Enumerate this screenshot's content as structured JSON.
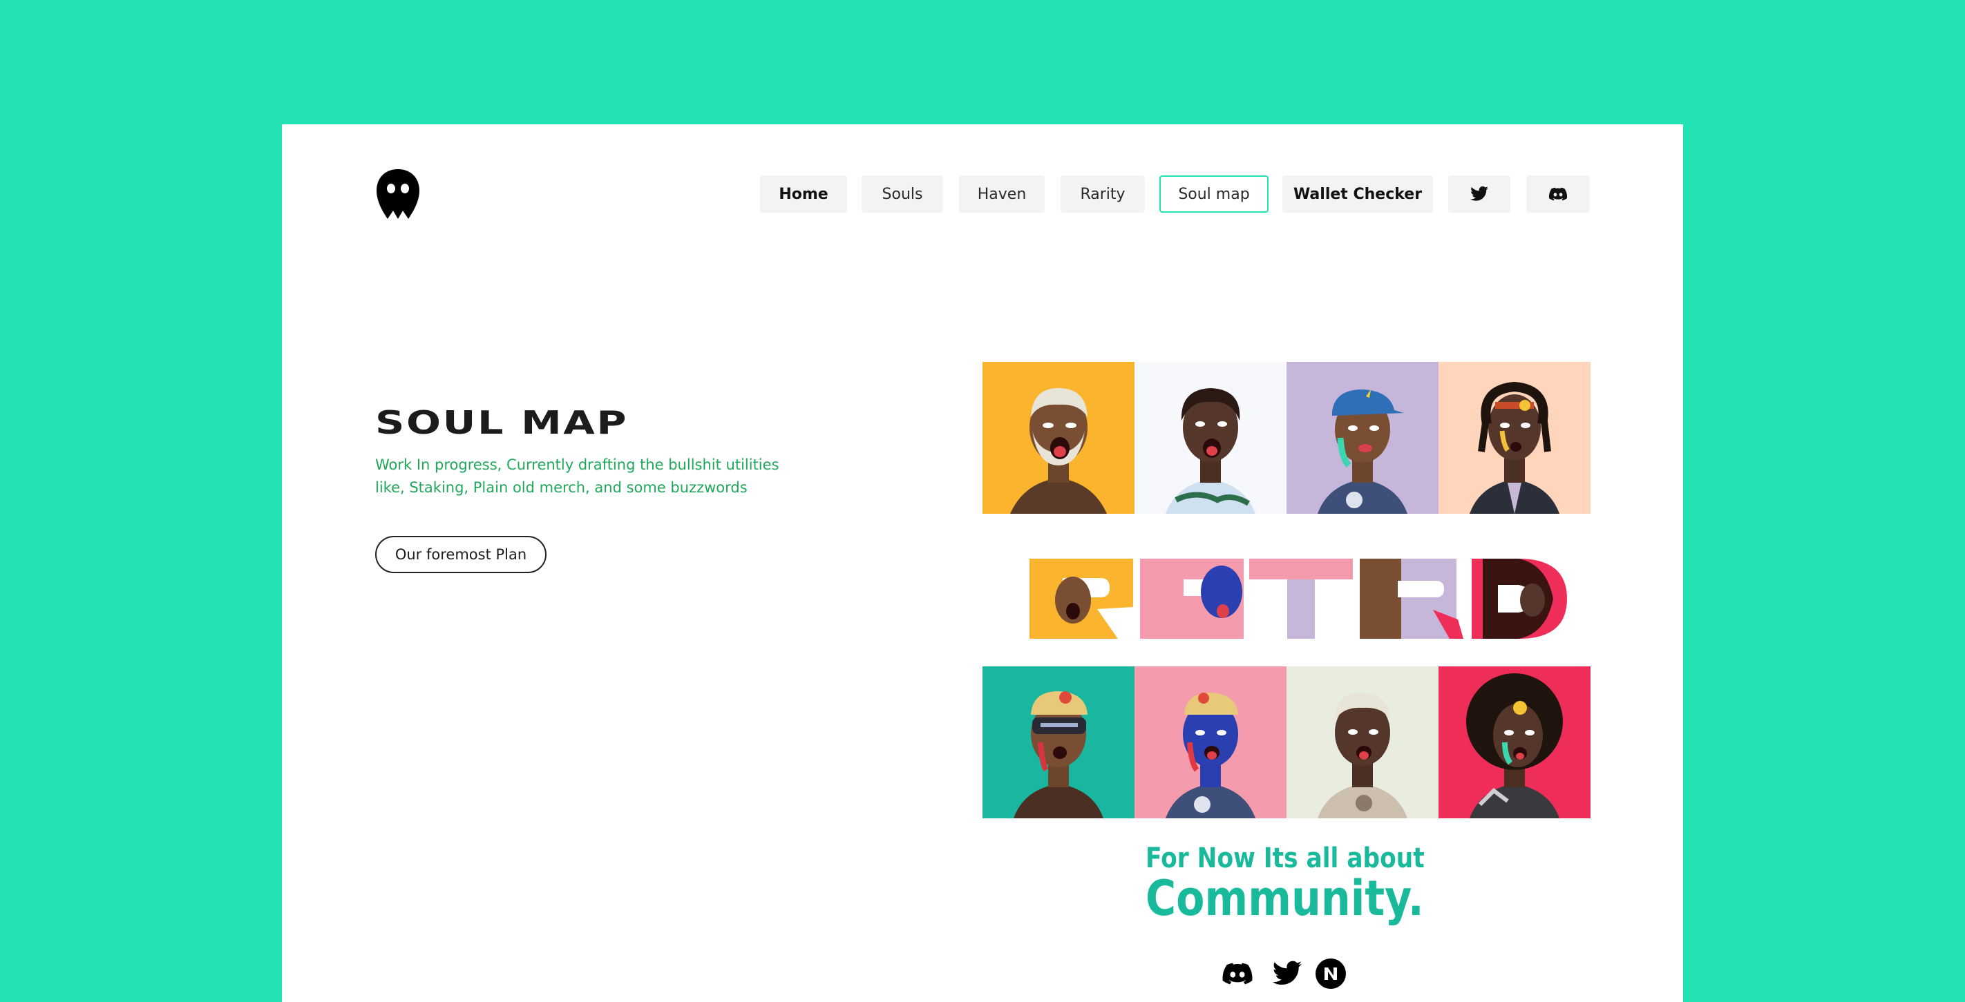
{
  "nav": {
    "items": [
      {
        "label": "Home",
        "state": "bold"
      },
      {
        "label": "Souls",
        "state": "normal"
      },
      {
        "label": "Haven",
        "state": "normal"
      },
      {
        "label": "Rarity",
        "state": "normal"
      },
      {
        "label": "Soul map",
        "state": "active"
      },
      {
        "label": "Wallet Checker",
        "state": "semibold"
      }
    ],
    "icons": [
      "twitter-icon",
      "discord-icon"
    ]
  },
  "hero": {
    "title": "SOUL MAP",
    "description": "Work In progress, Currently drafting the bullshit utilities like, Staking, Plain old merch, and some buzzwords",
    "button_label": "Our foremost Plan"
  },
  "gallery": {
    "top_row_colors": [
      "#FBB42E",
      "#F7F8FB",
      "#C6B7DA",
      "#FFD6BB"
    ],
    "bottom_row_colors": [
      "#1BB6A0",
      "#F59BAE",
      "#E8EDE0",
      "#EE2E59"
    ],
    "word": "RPTRD"
  },
  "community": {
    "line1": "For Now Its all about",
    "line2": "Community."
  },
  "footer_icons": [
    "discord-icon",
    "twitter-icon",
    "magic-eden-icon"
  ],
  "colors": {
    "page_background": "#23E3B4",
    "accent_green": "#1fa85a",
    "community_teal": "#19B99C"
  }
}
